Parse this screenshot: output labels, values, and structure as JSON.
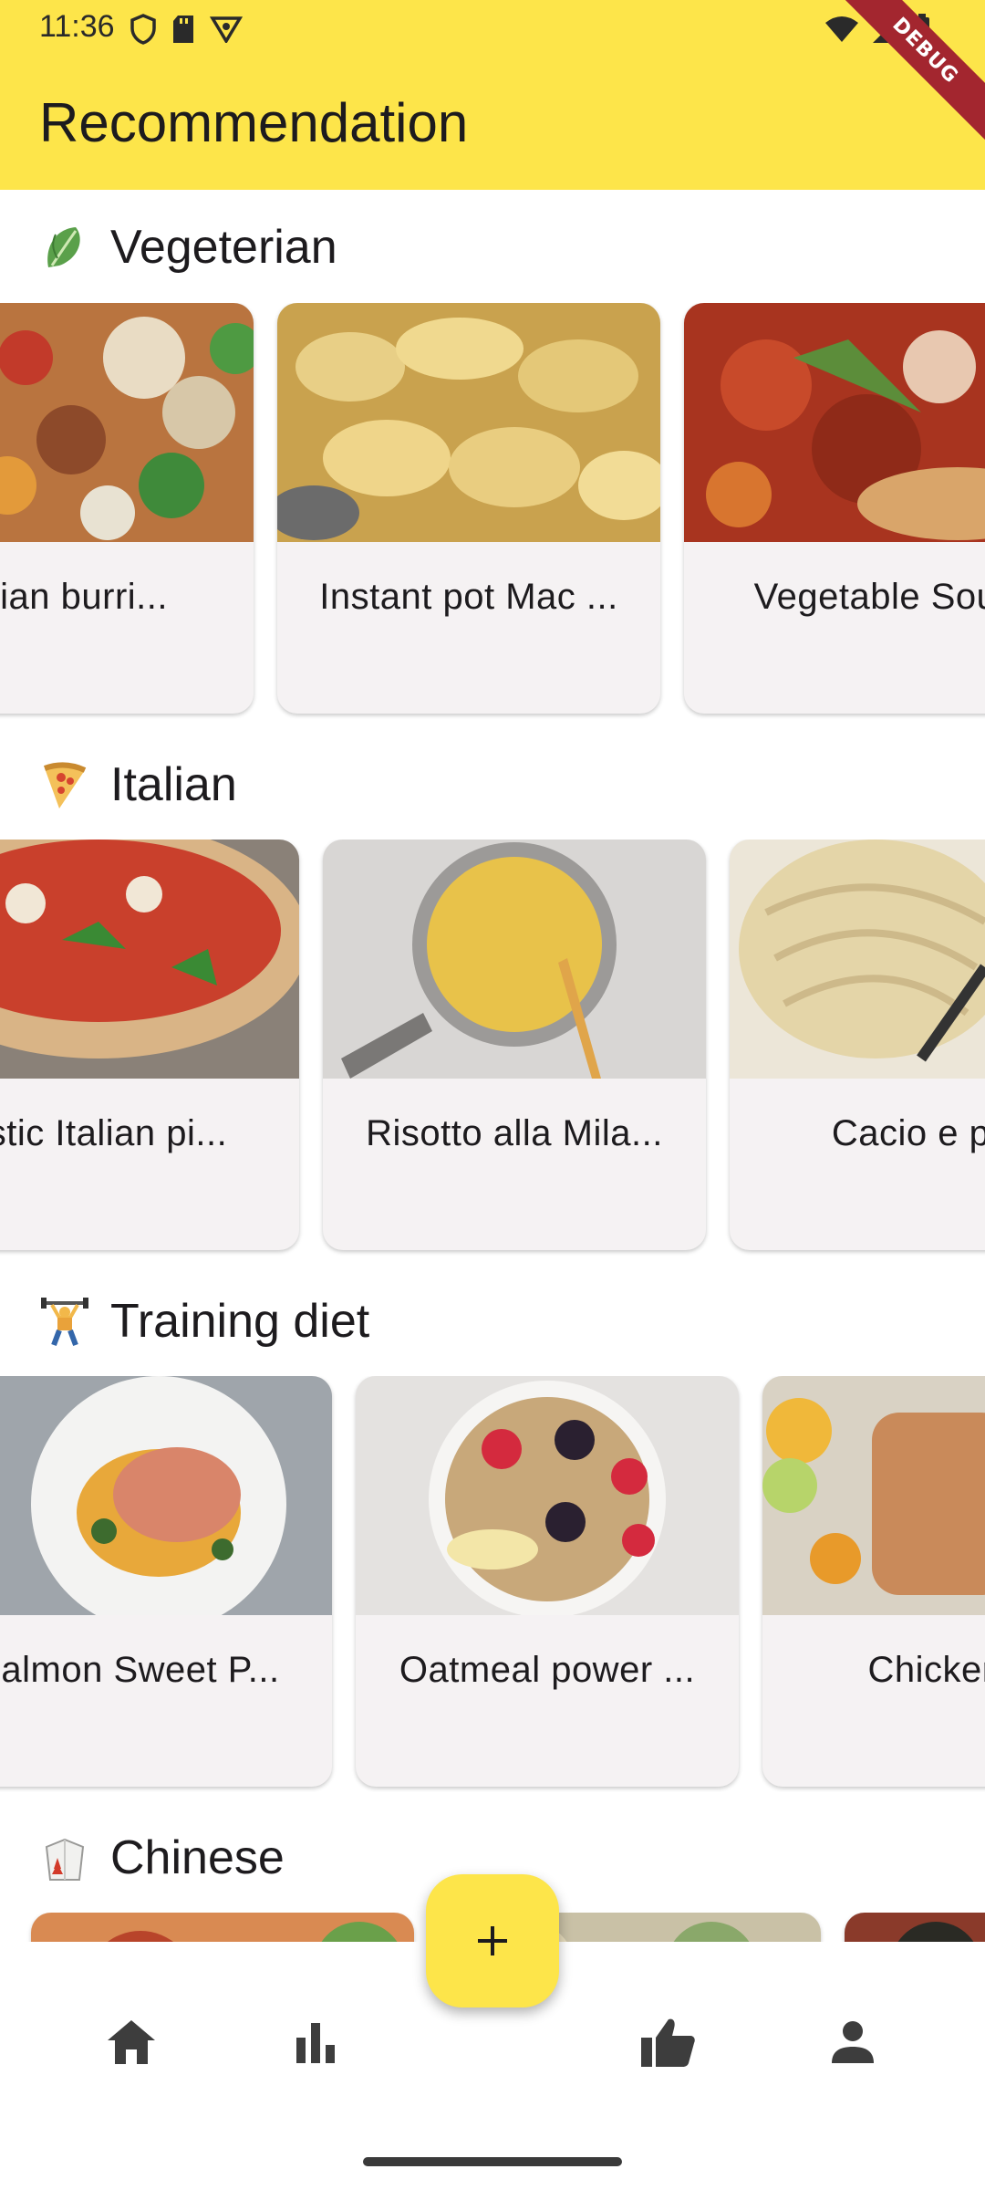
{
  "status_bar": {
    "time": "11:36"
  },
  "app_bar": {
    "title": "Recommendation",
    "debug_label": "DEBUG"
  },
  "sections": [
    {
      "title": "Vegeterian",
      "emoji_icon": "leafy-green-icon",
      "cards": [
        {
          "title": "tarian burri..."
        },
        {
          "title": "Instant pot Mac ..."
        },
        {
          "title": "Vegetable Sou"
        }
      ]
    },
    {
      "title": "Italian",
      "emoji_icon": "pizza-icon",
      "cards": [
        {
          "title": "stic Italian pi..."
        },
        {
          "title": "Risotto alla Mila..."
        },
        {
          "title": "Cacio e pe"
        }
      ]
    },
    {
      "title": "Training diet",
      "emoji_icon": "weight-lifter-icon",
      "cards": [
        {
          "title": "almon Sweet P..."
        },
        {
          "title": "Oatmeal power ..."
        },
        {
          "title": "Chicken C"
        }
      ]
    },
    {
      "title": "Chinese",
      "emoji_icon": "takeout-box-icon",
      "cards": []
    }
  ],
  "fab": {
    "icon": "plus-icon"
  },
  "bottom_nav": [
    {
      "icon": "home-icon"
    },
    {
      "icon": "bar-chart-icon"
    },
    {
      "icon": "thumbs-up-icon"
    },
    {
      "icon": "person-icon"
    }
  ],
  "colors": {
    "accent": "#fde54a",
    "card_bg": "#f5f2f3",
    "text": "#1d1b1e"
  }
}
